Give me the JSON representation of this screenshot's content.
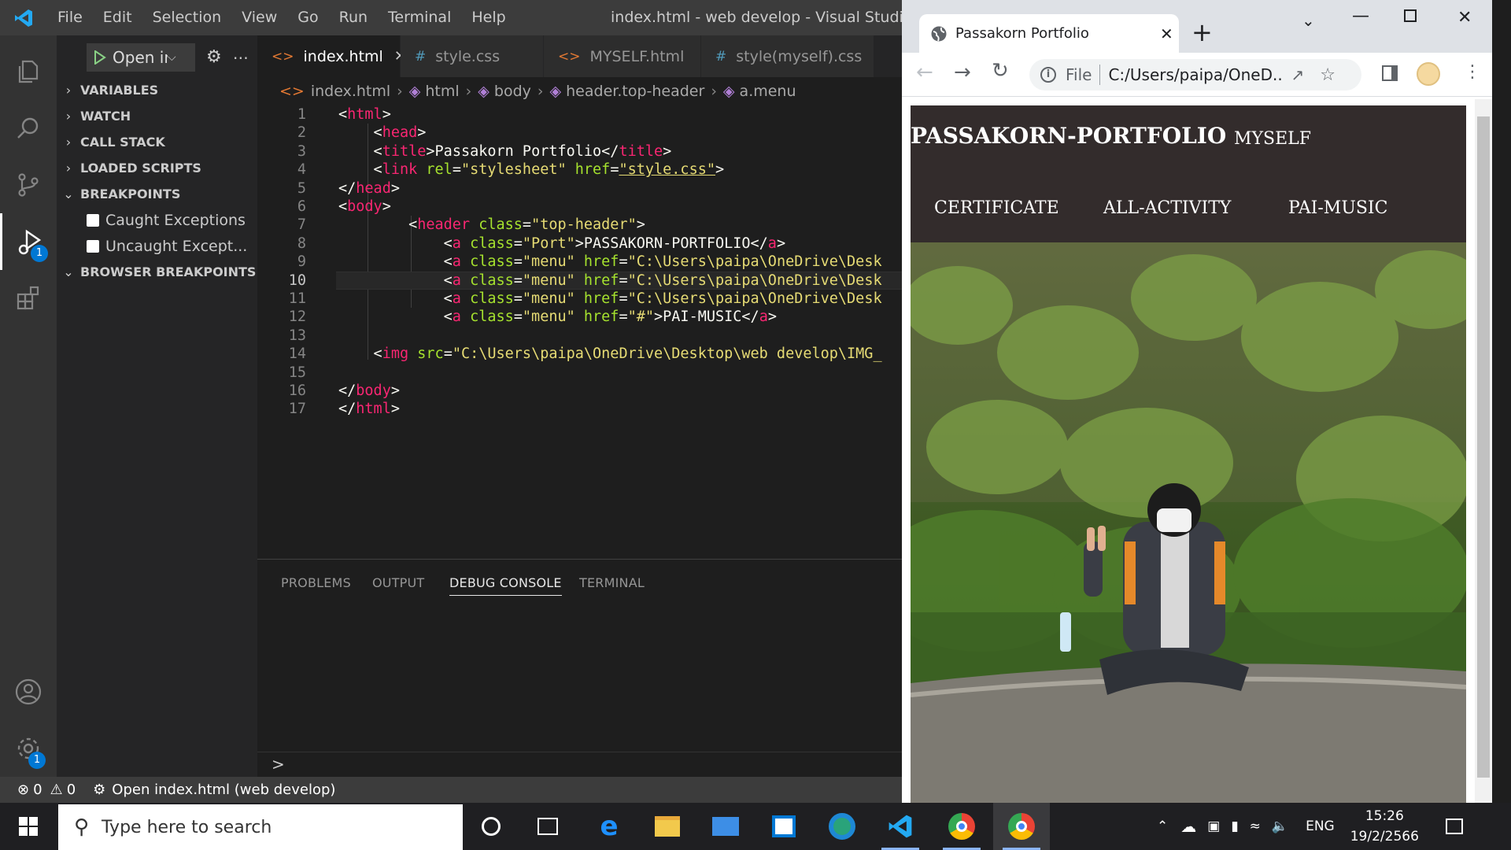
{
  "vscode": {
    "menu": [
      "File",
      "Edit",
      "Selection",
      "View",
      "Go",
      "Run",
      "Terminal",
      "Help"
    ],
    "window_title": "index.html - web develop - Visual Studio Code",
    "debug_badge": "1",
    "settings_badge": "1",
    "run_button_label": "Open ir",
    "sections": {
      "variables": "VARIABLES",
      "watch": "WATCH",
      "call_stack": "CALL STACK",
      "loaded_scripts": "LOADED SCRIPTS",
      "breakpoints": "BREAKPOINTS",
      "browser_breakpoints": "BROWSER BREAKPOINTS"
    },
    "breakpoint_items": [
      "Caught Exceptions",
      "Uncaught Except..."
    ],
    "tabs": [
      {
        "label": "index.html",
        "icon": "<>",
        "active": true
      },
      {
        "label": "style.css",
        "icon": "#"
      },
      {
        "label": "MYSELF.html",
        "icon": "<>"
      },
      {
        "label": "style(myself).css",
        "icon": "#"
      }
    ],
    "breadcrumb": [
      "index.html",
      "html",
      "body",
      "header.top-header",
      "a.menu"
    ],
    "current_line": 10,
    "panel_tabs": [
      "PROBLEMS",
      "OUTPUT",
      "DEBUG CONSOLE",
      "TERMINAL"
    ],
    "active_panel": "DEBUG CONSOLE",
    "prompt": ">",
    "status": {
      "errors": "0",
      "warnings": "0",
      "launch": "Open index.html (web develop)"
    }
  },
  "code_lines": [
    [
      [
        "punc",
        "<"
      ],
      [
        "tag",
        "html"
      ],
      [
        "punc",
        ">"
      ]
    ],
    [
      [
        "punc",
        "    <"
      ],
      [
        "tag",
        "head"
      ],
      [
        "punc",
        ">"
      ]
    ],
    [
      [
        "punc",
        "    <"
      ],
      [
        "tag",
        "title"
      ],
      [
        "punc",
        ">"
      ],
      [
        "txt",
        "Passakorn Portfolio"
      ],
      [
        "punc",
        "</"
      ],
      [
        "tag",
        "title"
      ],
      [
        "punc",
        ">"
      ]
    ],
    [
      [
        "punc",
        "    <"
      ],
      [
        "tag",
        "link"
      ],
      [
        "txt",
        " "
      ],
      [
        "attr",
        "rel"
      ],
      [
        "punc",
        "="
      ],
      [
        "str",
        "\"stylesheet\""
      ],
      [
        "txt",
        " "
      ],
      [
        "attr",
        "href"
      ],
      [
        "punc",
        "="
      ],
      [
        "str",
        "\"style.css\""
      ],
      [
        "punc",
        ">"
      ]
    ],
    [
      [
        "punc",
        "</"
      ],
      [
        "tag",
        "head"
      ],
      [
        "punc",
        ">"
      ]
    ],
    [
      [
        "punc",
        "<"
      ],
      [
        "tag",
        "body"
      ],
      [
        "punc",
        ">"
      ]
    ],
    [
      [
        "punc",
        "        <"
      ],
      [
        "tag",
        "header"
      ],
      [
        "txt",
        " "
      ],
      [
        "attr",
        "class"
      ],
      [
        "punc",
        "="
      ],
      [
        "str",
        "\"top-header\""
      ],
      [
        "punc",
        ">"
      ]
    ],
    [
      [
        "punc",
        "            <"
      ],
      [
        "tag",
        "a"
      ],
      [
        "txt",
        " "
      ],
      [
        "attr",
        "class"
      ],
      [
        "punc",
        "="
      ],
      [
        "str",
        "\"Port\""
      ],
      [
        "punc",
        ">"
      ],
      [
        "txt",
        "PASSAKORN-PORTFOLIO"
      ],
      [
        "punc",
        "</"
      ],
      [
        "tag",
        "a"
      ],
      [
        "punc",
        ">"
      ]
    ],
    [
      [
        "punc",
        "            <"
      ],
      [
        "tag",
        "a"
      ],
      [
        "txt",
        " "
      ],
      [
        "attr",
        "class"
      ],
      [
        "punc",
        "="
      ],
      [
        "str",
        "\"menu\""
      ],
      [
        "txt",
        " "
      ],
      [
        "attr",
        "href"
      ],
      [
        "punc",
        "="
      ],
      [
        "str",
        "\"C:\\Users\\paipa\\OneDrive\\Desk"
      ]
    ],
    [
      [
        "punc",
        "            <"
      ],
      [
        "tag",
        "a"
      ],
      [
        "txt",
        " "
      ],
      [
        "attr",
        "class"
      ],
      [
        "punc",
        "="
      ],
      [
        "str",
        "\"menu\""
      ],
      [
        "txt",
        " "
      ],
      [
        "attr",
        "href"
      ],
      [
        "punc",
        "="
      ],
      [
        "str",
        "\"C:\\Users\\paipa\\OneDrive\\Desk"
      ]
    ],
    [
      [
        "punc",
        "            <"
      ],
      [
        "tag",
        "a"
      ],
      [
        "txt",
        " "
      ],
      [
        "attr",
        "class"
      ],
      [
        "punc",
        "="
      ],
      [
        "str",
        "\"menu\""
      ],
      [
        "txt",
        " "
      ],
      [
        "attr",
        "href"
      ],
      [
        "punc",
        "="
      ],
      [
        "str",
        "\"C:\\Users\\paipa\\OneDrive\\Desk"
      ]
    ],
    [
      [
        "punc",
        "            <"
      ],
      [
        "tag",
        "a"
      ],
      [
        "txt",
        " "
      ],
      [
        "attr",
        "class"
      ],
      [
        "punc",
        "="
      ],
      [
        "str",
        "\"menu\""
      ],
      [
        "txt",
        " "
      ],
      [
        "attr",
        "href"
      ],
      [
        "punc",
        "="
      ],
      [
        "str",
        "\"#\""
      ],
      [
        "punc",
        ">"
      ],
      [
        "txt",
        "PAI-MUSIC"
      ],
      [
        "punc",
        "</"
      ],
      [
        "tag",
        "a"
      ],
      [
        "punc",
        ">"
      ]
    ],
    [],
    [
      [
        "punc",
        "    <"
      ],
      [
        "tag",
        "img"
      ],
      [
        "txt",
        " "
      ],
      [
        "attr",
        "src"
      ],
      [
        "punc",
        "="
      ],
      [
        "str",
        "\"C:\\Users\\paipa\\OneDrive\\Desktop\\web develop\\IMG_"
      ]
    ],
    [],
    [
      [
        "punc",
        "</"
      ],
      [
        "tag",
        "body"
      ],
      [
        "punc",
        ">"
      ]
    ],
    [
      [
        "punc",
        "</"
      ],
      [
        "tag",
        "html"
      ],
      [
        "punc",
        ">"
      ]
    ]
  ],
  "chrome": {
    "tab_title": "Passakorn Portfolio",
    "new_tab": "+",
    "url_scheme": "File",
    "url": "C:/Users/paipa/OneD...",
    "site": {
      "brand": "PASSAKORN-PORTFOLIO",
      "menu": [
        "MYSELF",
        "CERTIFICATE",
        "ALL-ACTIVITY",
        "PAI-MUSIC"
      ],
      "header_color": "#332c2c"
    }
  },
  "taskbar": {
    "search_placeholder": "Type here to search",
    "lang": "ENG",
    "time": "15:26",
    "date": "19/2/2566"
  },
  "colors": {
    "accent": "#0078d4",
    "tag": "#f92672",
    "attr": "#a6e22e",
    "string": "#e6db74"
  }
}
